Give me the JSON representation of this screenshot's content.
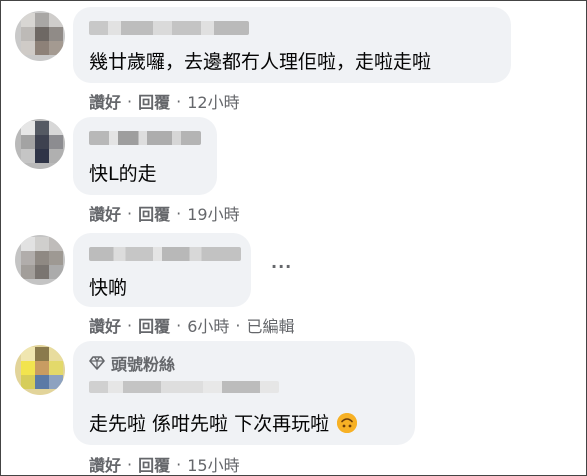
{
  "comments": [
    {
      "text": "幾廿歲囉，去邊都冇人理佢啦，走啦走啦",
      "like": "讚好",
      "reply": "回覆",
      "time": "12小時",
      "edited": ""
    },
    {
      "text": "快L的走",
      "like": "讚好",
      "reply": "回覆",
      "time": "19小時",
      "edited": ""
    },
    {
      "text": "快啲",
      "like": "讚好",
      "reply": "回覆",
      "time": "6小時",
      "edited": "已編輯",
      "more": "···"
    },
    {
      "badge": "頭號粉絲",
      "text": "走先啦 係咁先啦 下次再玩啦",
      "like": "讚好",
      "reply": "回覆",
      "time": "15小時",
      "edited": ""
    }
  ],
  "separator": "·",
  "icons": {
    "badge": "diamond-icon",
    "emoji": "upside-down-face-emoji-icon",
    "more": "more-options-icon"
  },
  "colors": {
    "bubble": "#f0f2f5",
    "meta": "#65676b",
    "text": "#050505",
    "emoji": "#f7b125"
  }
}
